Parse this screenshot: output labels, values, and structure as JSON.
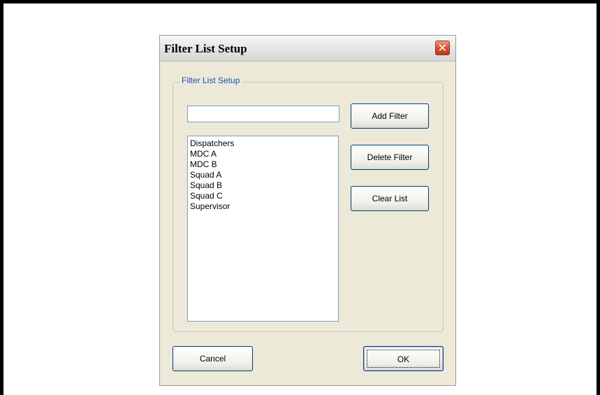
{
  "dialog": {
    "title": "Filter List Setup",
    "close_glyph": "✕"
  },
  "group": {
    "label": "Filter List Setup"
  },
  "filter_input": {
    "value": ""
  },
  "filters": [
    "Dispatchers",
    "MDC A",
    "MDC B",
    "Squad A",
    "Squad B",
    "Squad C",
    "Supervisor"
  ],
  "buttons": {
    "add": "Add Filter",
    "delete": "Delete Filter",
    "clear": "Clear List",
    "cancel": "Cancel",
    "ok": "OK"
  },
  "colors": {
    "group_label": "#1b4fb8",
    "dialog_bg": "#ece9d8",
    "close_button": "#d5492b"
  }
}
